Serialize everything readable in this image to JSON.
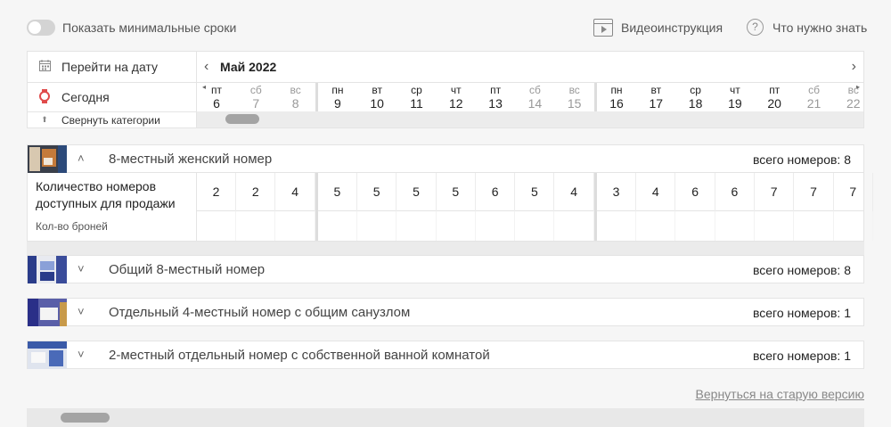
{
  "topbar": {
    "min_terms_label": "Показать минимальные сроки",
    "video_label": "Видеоинструкция",
    "help_label": "Что нужно знать"
  },
  "calendar": {
    "goto_date_label": "Перейти на дату",
    "today_label": "Сегодня",
    "collapse_label": "Свернуть категории",
    "month": "Май 2022",
    "days": [
      {
        "dw": "пт",
        "dn": "6",
        "weekend": false
      },
      {
        "dw": "сб",
        "dn": "7",
        "weekend": true
      },
      {
        "dw": "вс",
        "dn": "8",
        "weekend": true
      },
      {
        "dw": "пн",
        "dn": "9",
        "weekend": false
      },
      {
        "dw": "вт",
        "dn": "10",
        "weekend": false
      },
      {
        "dw": "ср",
        "dn": "11",
        "weekend": false
      },
      {
        "dw": "чт",
        "dn": "12",
        "weekend": false
      },
      {
        "dw": "пт",
        "dn": "13",
        "weekend": false
      },
      {
        "dw": "сб",
        "dn": "14",
        "weekend": true
      },
      {
        "dw": "вс",
        "dn": "15",
        "weekend": true
      },
      {
        "dw": "пн",
        "dn": "16",
        "weekend": false
      },
      {
        "dw": "вт",
        "dn": "17",
        "weekend": false
      },
      {
        "dw": "ср",
        "dn": "18",
        "weekend": false
      },
      {
        "dw": "чт",
        "dn": "19",
        "weekend": false
      },
      {
        "dw": "пт",
        "dn": "20",
        "weekend": false
      },
      {
        "dw": "сб",
        "dn": "21",
        "weekend": true
      },
      {
        "dw": "вс",
        "dn": "22",
        "weekend": true
      }
    ]
  },
  "rooms": [
    {
      "name": "8-местный женский номер",
      "total": "всего номеров: 8",
      "expanded": true
    },
    {
      "name": "Общий 8-местный номер",
      "total": "всего номеров: 8",
      "expanded": false
    },
    {
      "name": "Отдельный 4-местный номер с общим санузлом",
      "total": "всего номеров: 1",
      "expanded": false
    },
    {
      "name": "2-местный отдельный номер с собственной ванной комнатой",
      "total": "всего номеров: 1",
      "expanded": false
    }
  ],
  "availability": {
    "label": "Количество номеров доступных для продажи",
    "bookings_label": "Кол-во броней",
    "values": [
      "2",
      "2",
      "4",
      "5",
      "5",
      "5",
      "5",
      "6",
      "5",
      "4",
      "3",
      "4",
      "6",
      "6",
      "7",
      "7",
      "7"
    ]
  },
  "footer": {
    "old_version_link": "Вернуться на старую версию"
  },
  "colors": {
    "background": "#f6f6f6",
    "border": "#e4e4e4",
    "weekend_text": "#999999"
  }
}
